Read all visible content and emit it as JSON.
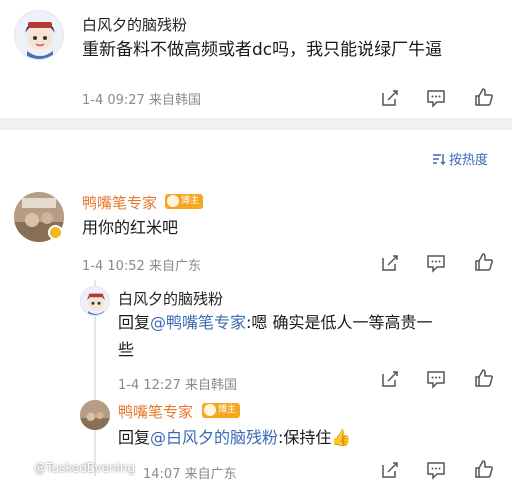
{
  "post": {
    "author": "白风夕的脑残粉",
    "text": "重新备料不做高频或者dc吗，我只能说绿厂牛逼",
    "meta": "1-4 09:27  来自韩国"
  },
  "sort": {
    "label": "按热度"
  },
  "comment1": {
    "author": "鸭嘴笔专家",
    "badge": "博主",
    "text": "用你的红米吧",
    "meta": "1-4 10:52  来自广东"
  },
  "reply1": {
    "author": "白风夕的脑残粉",
    "prefix": "回复",
    "mention": "@鸭嘴笔专家",
    "text_line1": ":嗯 确实是低人一等高贵一",
    "text_line2": "些",
    "meta": "1-4 12:27  来自韩国"
  },
  "reply2": {
    "author": "鸭嘴笔专家",
    "badge": "博主",
    "prefix": "回复",
    "mention": "@白风夕的脑残粉",
    "text": ":保持住👍",
    "meta_tail": "14:07  来自广东"
  },
  "watermark": {
    "text": "@TuskedEvening"
  },
  "icons": [
    "edit-icon",
    "comment-icon",
    "like-icon",
    "sort-icon",
    "weibo-logo-icon"
  ],
  "colors": {
    "accent_orange": "#e8772e",
    "link_blue": "#3c69b3",
    "meta_gray": "#8a8a8a",
    "separator": "#f1f1f1",
    "badge": "#f5a623"
  }
}
